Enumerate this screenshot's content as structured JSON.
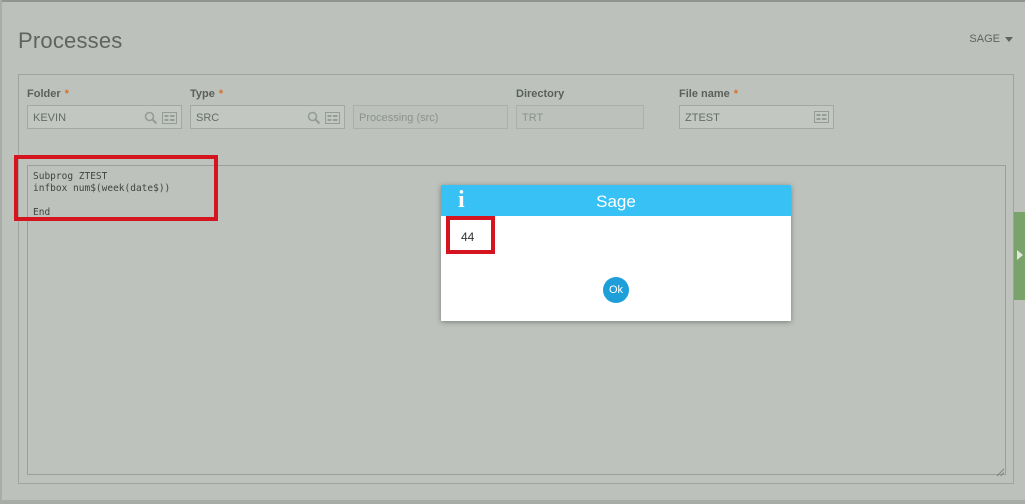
{
  "page": {
    "title": "Processes",
    "user_menu_label": "SAGE"
  },
  "form": {
    "folder": {
      "label": "Folder",
      "required": "*",
      "value": "KEVIN"
    },
    "type": {
      "label": "Type",
      "required": "*",
      "value": "SRC"
    },
    "type_description": {
      "value": "Processing (src)"
    },
    "directory": {
      "label": "Directory",
      "value": "TRT"
    },
    "file_name": {
      "label": "File name",
      "required": "*",
      "value": "ZTEST"
    }
  },
  "editor": {
    "lines": [
      "Subprog ZTEST",
      "infbox num$(week(date$))",
      "",
      "End"
    ]
  },
  "dialog": {
    "title": "Sage",
    "info_icon": "i",
    "message": "44",
    "ok_label": "Ok"
  },
  "colors": {
    "background": "#bcc1bb",
    "dialog_header": "#37c1f5",
    "ok_button": "#1f9fd9",
    "required_star": "#d97028",
    "highlight": "#d4141e",
    "side_tab": "#7aa36b"
  },
  "icons": {
    "search": "search-icon",
    "selection": "selection-icon",
    "dropdown": "caret-down-icon",
    "info": "info-icon",
    "resize": "resize-grip-icon",
    "side_tab": "expand-arrow-icon"
  }
}
